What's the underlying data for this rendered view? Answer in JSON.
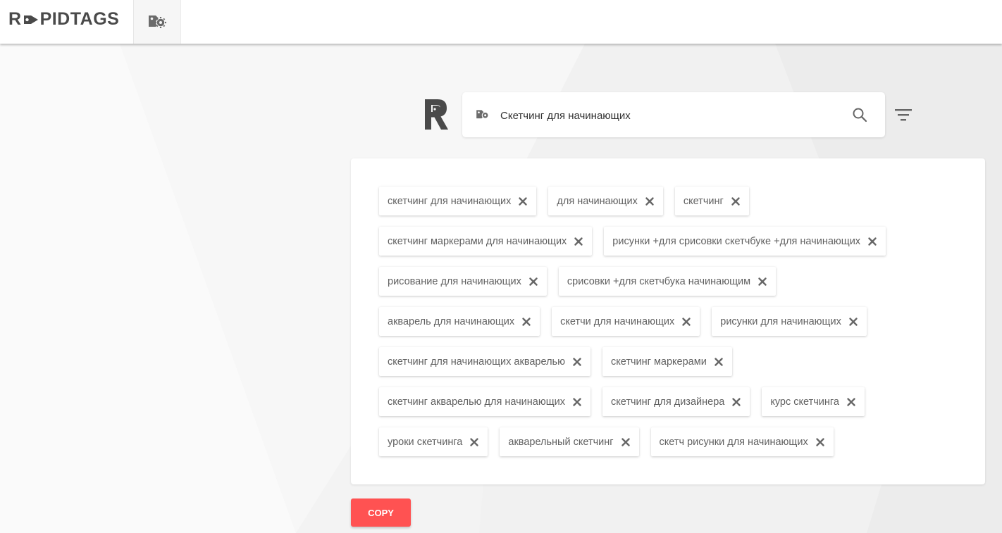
{
  "header": {
    "logo_text_left": "R",
    "logo_text_right": "PIDTAGS",
    "tab_icon": "tag-gear-icon"
  },
  "search": {
    "value": "Скетчинг для начинающих",
    "placeholder": "",
    "leading_icon": "tag-gear-icon",
    "trailing_icon": "search-icon"
  },
  "filter_icon": "filter-icon",
  "tags": {
    "rows": [
      [
        "скетчинг для начинающих",
        "для начинающих",
        "скетчинг"
      ],
      [
        "скетчинг маркерами для начинающих",
        "рисунки +для срисовки скетчбуке +для начинающих"
      ],
      [
        "рисование для начинающих",
        "срисовки +для скетчбука начинающим"
      ],
      [
        "акварель для начинающих",
        "скетчи для начинающих",
        "рисунки для начинающих"
      ],
      [
        "скетчинг для начинающих акварелью",
        "скетчинг маркерами"
      ],
      [
        "скетчинг акварелью для начинающих",
        "скетчинг для дизайнера",
        "курс скетчинга"
      ],
      [
        "уроки скетчинга",
        "акварельный скетчинг",
        "скетч рисунки для начинающих"
      ]
    ],
    "remove_icon": "close-icon"
  },
  "actions": {
    "copy_label": "COPY"
  },
  "colors": {
    "accent": "#ff5252",
    "logo": "#4a4a4a",
    "chip_text": "#616161",
    "background": "#f3f3f3"
  }
}
